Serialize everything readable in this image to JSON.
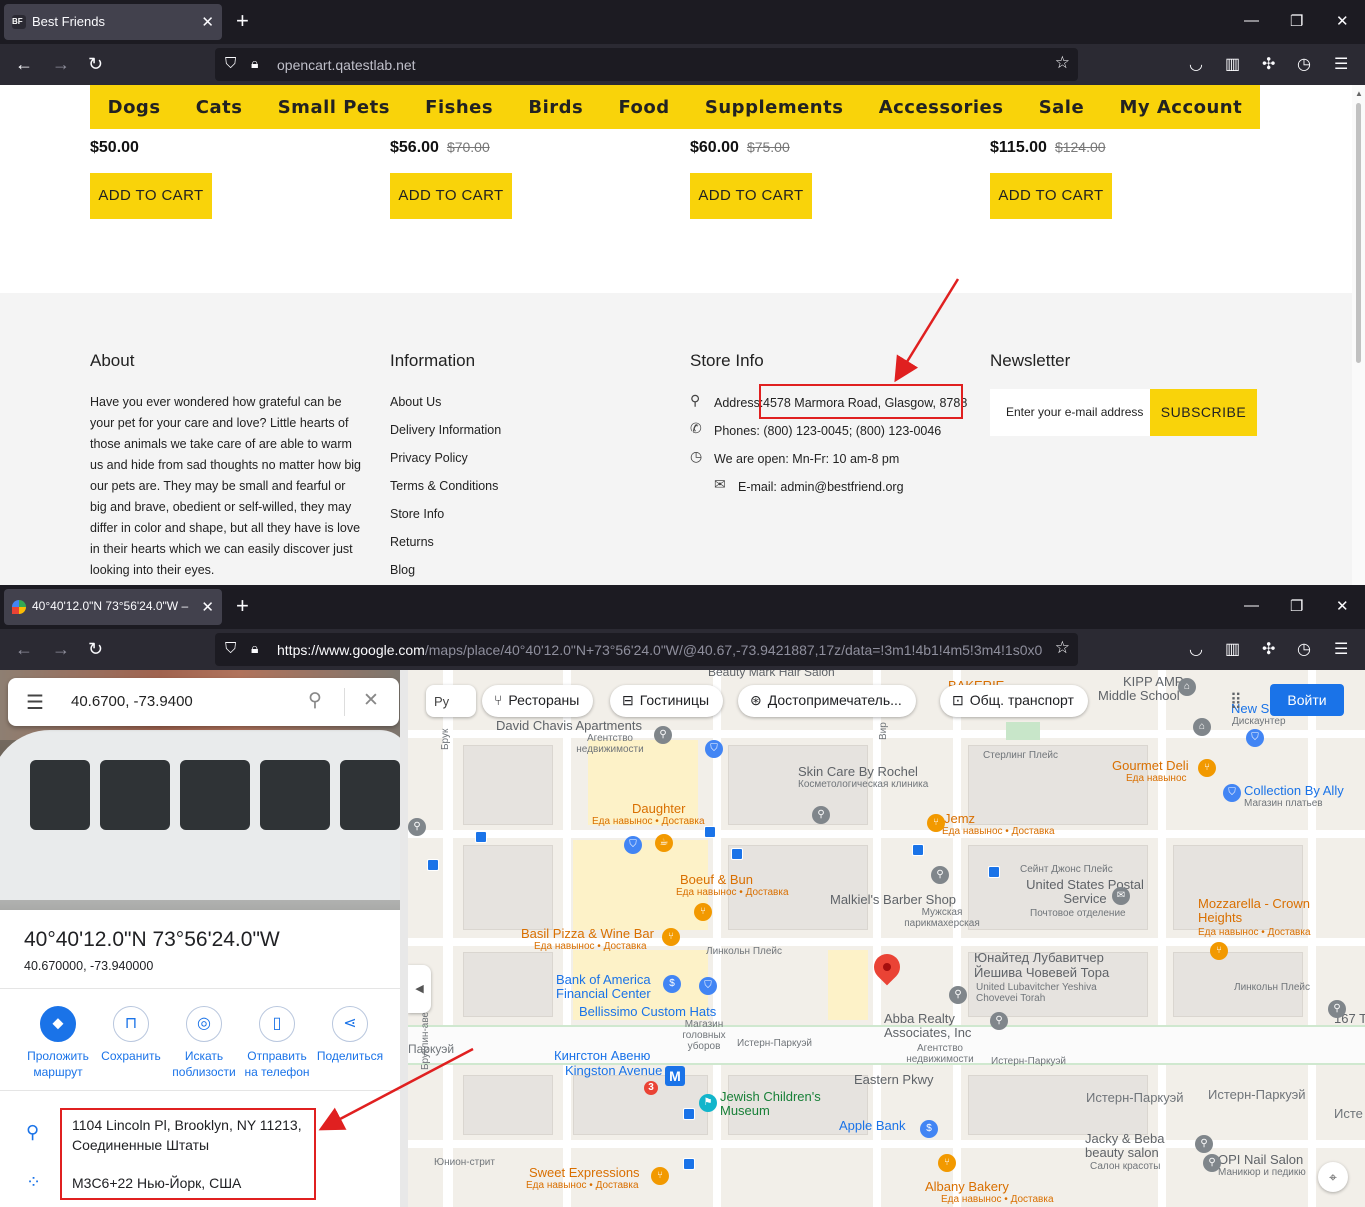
{
  "top_window": {
    "tab_title": "Best Friends",
    "url": "opencart.qatestlab.net"
  },
  "shop": {
    "menu": [
      "Dogs",
      "Cats",
      "Small Pets",
      "Fishes",
      "Birds",
      "Food",
      "Supplements",
      "Accessories",
      "Sale",
      "My Account"
    ],
    "products": [
      {
        "price": "$50.00",
        "old_price": ""
      },
      {
        "price": "$56.00",
        "old_price": "$70.00"
      },
      {
        "price": "$60.00",
        "old_price": "$75.00"
      },
      {
        "price": "$115.00",
        "old_price": "$124.00"
      }
    ],
    "add_to_cart": "ADD TO CART",
    "footer": {
      "about_title": "About",
      "about_text": "Have you ever wondered how grateful can be your pet for your care and love? Little hearts of those animals we take care of are able to warm us and hide from sad thoughts no matter how big our pets are. They may be small and fearful or big and brave, obedient or self-willed, they may differ in color and shape, but all they have is love in their hearts which we can easily discover just looking into their eyes.",
      "info_title": "Information",
      "info_links": [
        "About Us",
        "Delivery Information",
        "Privacy Policy",
        "Terms & Conditions",
        "Store Info",
        "Returns",
        "Blog"
      ],
      "store_title": "Store Info",
      "address_label": "Address:",
      "address_value": "4578 Marmora Road, Glasgow, 8788",
      "phones": "Phones: (800) 123-0045; (800) 123-0046",
      "open": "We are open: Mn-Fr: 10 am-8 pm",
      "email": "E-mail: admin@bestfriend.org",
      "news_title": "Newsletter",
      "news_placeholder": "Enter your e-mail address",
      "subscribe": "SUBSCRIBE"
    }
  },
  "bottom_window": {
    "tab_title": "40°40'12.0\"N 73°56'24.0\"W – Go",
    "url_host": "https://www.google.com",
    "url_rest": "/maps/place/40°40'12.0\"N+73°56'24.0\"W/@40.67,-73.9421887,17z/data=!3m1!4b1!4m5!3m4!1s0x0"
  },
  "maps": {
    "search_value": "40.6700, -73.9400",
    "place_title": "40°40'12.0\"N 73°56'24.0\"W",
    "place_decimal": "40.670000, -73.940000",
    "actions": [
      {
        "label": "Проложить маршрут",
        "icon": "directions-icon"
      },
      {
        "label": "Сохранить",
        "icon": "bookmark-icon"
      },
      {
        "label": "Искать поблизости",
        "icon": "nearby-icon"
      },
      {
        "label": "Отправить на телефон",
        "icon": "send-to-phone-icon"
      },
      {
        "label": "Поделиться",
        "icon": "share-icon"
      }
    ],
    "address_line1": "1104 Lincoln Pl, Brooklyn, NY 11213,",
    "address_line2": "Соединенные Штаты",
    "plus_code": "M3C6+22 Нью-Йорк, США",
    "lang": "Ру",
    "chips": [
      "Рестораны",
      "Гостиницы",
      "Достопримечатель...",
      "Общ. транспорт"
    ],
    "login": "Войти",
    "labels": {
      "beauty": "Beauty Mark Hair Salon",
      "bakerie": "BAKERIE",
      "kipp": "KIPP AMP",
      "kipp2": "Middle School",
      "david": "David Chavis Apartments",
      "david_sub": "Агентство недвижимости",
      "skin": "Skin Care By Rochel",
      "skin_sub": "Косметологическая клиника",
      "sterling": "Стерлинг Плейс",
      "gourmet": "Gourmet Deli",
      "gourmet_sub": "Еда навынос",
      "new_s": "New S",
      "discount": "Дискаунтер",
      "daughter": "Daughter",
      "daughter_sub": "Еда навынос • Доставка",
      "jemz": "Jemz",
      "jemz_sub": "Еда навынос • Доставка",
      "collection": "Collection By Ally",
      "collection_sub": "Магазин платьев",
      "stjohns": "Сейнт Джонс Плейс",
      "usps": "United States Postal Service",
      "usps_sub": "Почтовое отделение",
      "boeuf": "Boeuf & Bun",
      "boeuf_sub": "Еда навынос • Доставка",
      "malkiel": "Malkiel's Barber Shop",
      "malkiel_sub": "Мужская парикмахерская",
      "mozz": "Mozzarella - Crown Heights",
      "mozz_sub": "Еда навынос • Доставка",
      "basil": "Basil Pizza & Wine Bar",
      "basil_sub": "Еда навынос • Доставка",
      "lincoln_st": "Линкольн Плейс",
      "yeshiva": "Юнайтед Лубавитчер Йешива Човевей Тора",
      "yeshiva_sub": "United Lubavitcher Yeshiva Chovevei Torah",
      "lincoln_st2": "Линкольн Плейс",
      "bofa": "Bank of America Financial Center",
      "bellissimo": "Bellissimo Custom Hats",
      "bellissimo_sub": "Магазин головных уборов",
      "abba": "Abba Realty Associates, Inc",
      "abba_sub": "Агентство недвижимости",
      "p167": "167 T",
      "parkway_rus": "Паркуэй",
      "eastern_rus": "Истерн-Паркуэй",
      "eastern_rus2": "Истерн-Паркуэй",
      "kingston_ru": "Кингстон Авеню",
      "kingston": "Kingston Avenue",
      "eastern": "Eastern Pkwy",
      "eastern_rus3": "Истерн-Паркуэй",
      "eastern_rus4": "Истерн-Паркуэй",
      "easte": "Исте",
      "jcm": "Jewish Children's Museum",
      "apple": "Apple Bank",
      "jacky": "Jacky & Beba beauty salon",
      "jacky_sub": "Салон красоты",
      "opi": "OPI Nail Salon",
      "opi_sub": "Маникюр и педикю",
      "union": "Юнион-стрит",
      "sweet": "Sweet Expressions",
      "sweet_sub": "Еда навынос • Доставка",
      "albany": "Albany Bakery",
      "albany_sub": "Еда навынос • Доставка",
      "brooklyn": "Бруклин-авеню",
      "bru": "Брук",
      "vir": "Вир",
      "metro": "M",
      "line3": "3"
    }
  }
}
